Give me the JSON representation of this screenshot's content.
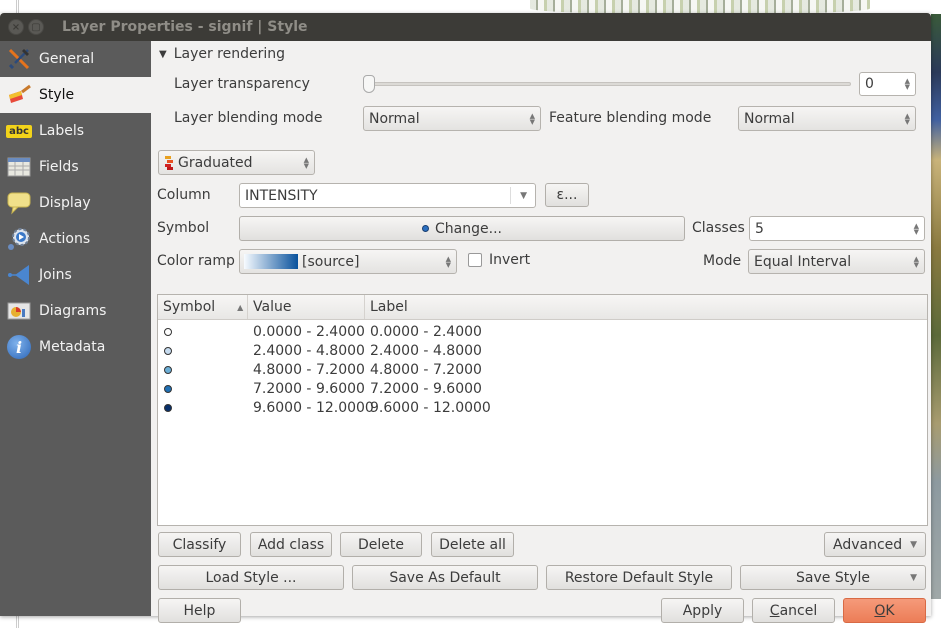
{
  "window": {
    "title": "Layer Properties - signif | Style",
    "close_glyph": "×",
    "maximize_glyph": "▢"
  },
  "sidebar": {
    "items": [
      {
        "label": "General",
        "icon": "tools-icon",
        "active": false
      },
      {
        "label": "Style",
        "icon": "paintbrush-icon",
        "active": true
      },
      {
        "label": "Labels",
        "icon": "abc-label-icon",
        "active": false
      },
      {
        "label": "Fields",
        "icon": "table-icon",
        "active": false
      },
      {
        "label": "Display",
        "icon": "speech-bubble-icon",
        "active": false
      },
      {
        "label": "Actions",
        "icon": "gear-play-icon",
        "active": false
      },
      {
        "label": "Joins",
        "icon": "join-icon",
        "active": false
      },
      {
        "label": "Diagrams",
        "icon": "diagram-icon",
        "active": false
      },
      {
        "label": "Metadata",
        "icon": "info-icon",
        "active": false
      }
    ],
    "labels_icon_text": "abc",
    "metadata_icon_text": "i"
  },
  "rendering": {
    "section_title": "Layer rendering",
    "transparency_label": "Layer transparency",
    "transparency_value": "0",
    "transparency_fraction": 0,
    "layer_blend_label": "Layer blending mode",
    "layer_blend_value": "Normal",
    "feature_blend_label": "Feature blending mode",
    "feature_blend_value": "Normal"
  },
  "renderer": {
    "type": "Graduated",
    "column_label": "Column",
    "column_value": "INTENSITY",
    "expression_button": "ε...",
    "symbol_label": "Symbol",
    "change_button": "Change...",
    "classes_label": "Classes",
    "classes_value": "5",
    "color_ramp_label": "Color ramp",
    "color_ramp_value": "[source]",
    "color_ramp_from": "#f7fbff",
    "color_ramp_to": "#08519c",
    "invert_label": "Invert",
    "invert_checked": false,
    "mode_label": "Mode",
    "mode_value": "Equal Interval"
  },
  "table": {
    "columns": [
      "Symbol",
      "Value",
      "Label"
    ],
    "sort_indicator": "▲",
    "rows": [
      {
        "color": "#ffffff",
        "value": "0.0000 - 2.4000",
        "label": "0.0000 - 2.4000"
      },
      {
        "color": "#c6dbef",
        "value": "2.4000 - 4.8000",
        "label": "2.4000 - 4.8000"
      },
      {
        "color": "#6baed6",
        "value": "4.8000 - 7.2000",
        "label": "4.8000 - 7.2000"
      },
      {
        "color": "#2171b5",
        "value": "7.2000 - 9.6000",
        "label": "7.2000 - 9.6000"
      },
      {
        "color": "#08306b",
        "value": "9.6000 - 12.0000",
        "label": "9.6000 - 12.0000"
      }
    ]
  },
  "buttons": {
    "classify": "Classify",
    "add_class": "Add class",
    "delete": "Delete",
    "delete_all": "Delete all",
    "advanced": "Advanced",
    "load_style": "Load Style ...",
    "save_as_default": "Save As Default",
    "restore_default": "Restore Default Style",
    "save_style": "Save Style",
    "help": "Help",
    "apply": "Apply",
    "cancel_mnemonic": "C",
    "cancel_rest": "ancel",
    "ok_mnemonic": "O",
    "ok_rest": "K"
  },
  "colors": {
    "ok_button": "#ec7d57",
    "titlebar": "#3c3b37",
    "sidebar": "#5b5b5b"
  }
}
